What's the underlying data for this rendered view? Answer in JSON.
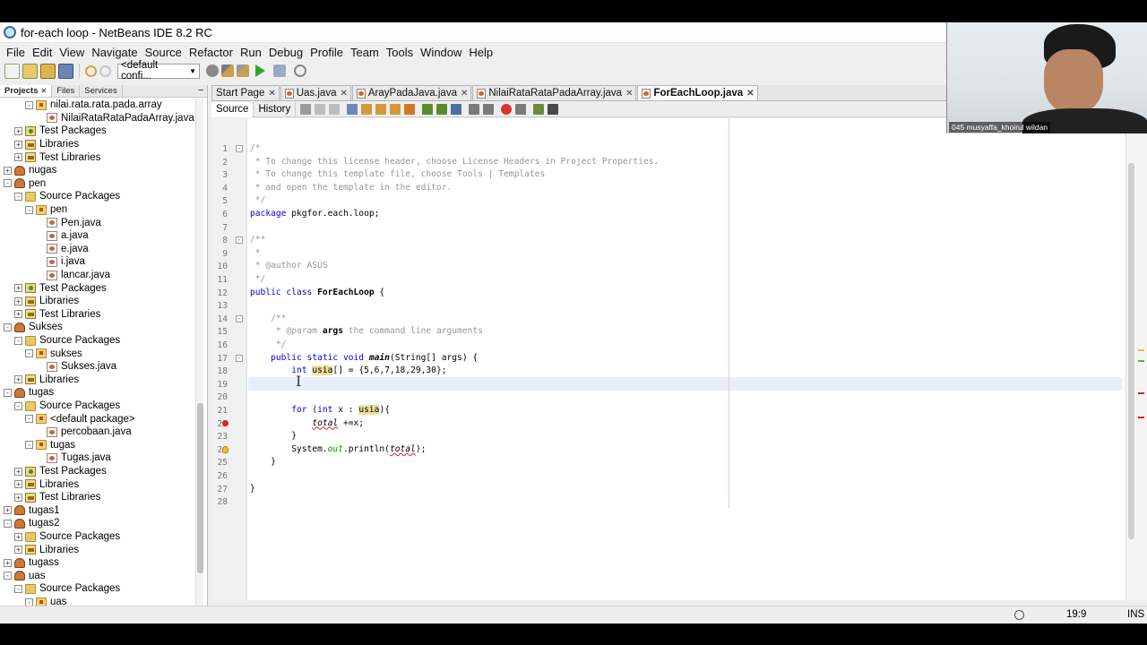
{
  "window": {
    "title": "for-each loop - NetBeans IDE 8.2 RC"
  },
  "menu": [
    "File",
    "Edit",
    "View",
    "Navigate",
    "Source",
    "Refactor",
    "Run",
    "Debug",
    "Profile",
    "Team",
    "Tools",
    "Window",
    "Help"
  ],
  "toolbar": {
    "config": "<default confi..."
  },
  "left_panel": {
    "tabs": [
      "Projects",
      "Files",
      "Services"
    ],
    "minimize": "–"
  },
  "tree": [
    {
      "indent": 2,
      "toggle": "-",
      "icon": "pkg",
      "label": "nilai.rata.rata.pada.array"
    },
    {
      "indent": 3,
      "toggle": "",
      "icon": "java",
      "label": "NilaiRataRataPadaArray.java"
    },
    {
      "indent": 1,
      "toggle": "+",
      "icon": "testpkg",
      "label": "Test Packages"
    },
    {
      "indent": 1,
      "toggle": "+",
      "icon": "libs",
      "label": "Libraries"
    },
    {
      "indent": 1,
      "toggle": "+",
      "icon": "libs",
      "label": "Test Libraries"
    },
    {
      "indent": 0,
      "toggle": "+",
      "icon": "project",
      "label": "nugas"
    },
    {
      "indent": 0,
      "toggle": "-",
      "icon": "project",
      "label": "pen"
    },
    {
      "indent": 1,
      "toggle": "-",
      "icon": "folder",
      "label": "Source Packages"
    },
    {
      "indent": 2,
      "toggle": "-",
      "icon": "pkg",
      "label": "pen"
    },
    {
      "indent": 3,
      "toggle": "",
      "icon": "java",
      "label": "Pen.java"
    },
    {
      "indent": 3,
      "toggle": "",
      "icon": "java",
      "label": "a.java"
    },
    {
      "indent": 3,
      "toggle": "",
      "icon": "java",
      "label": "e.java"
    },
    {
      "indent": 3,
      "toggle": "",
      "icon": "java",
      "label": "i.java"
    },
    {
      "indent": 3,
      "toggle": "",
      "icon": "java",
      "label": "lancar.java"
    },
    {
      "indent": 1,
      "toggle": "+",
      "icon": "testpkg",
      "label": "Test Packages"
    },
    {
      "indent": 1,
      "toggle": "+",
      "icon": "libs",
      "label": "Libraries"
    },
    {
      "indent": 1,
      "toggle": "+",
      "icon": "libs",
      "label": "Test Libraries"
    },
    {
      "indent": 0,
      "toggle": "-",
      "icon": "project",
      "label": "Sukses"
    },
    {
      "indent": 1,
      "toggle": "-",
      "icon": "folder",
      "label": "Source Packages"
    },
    {
      "indent": 2,
      "toggle": "-",
      "icon": "pkg",
      "label": "sukses"
    },
    {
      "indent": 3,
      "toggle": "",
      "icon": "java",
      "label": "Sukses.java"
    },
    {
      "indent": 1,
      "toggle": "+",
      "icon": "libs",
      "label": "Libraries"
    },
    {
      "indent": 0,
      "toggle": "-",
      "icon": "project",
      "label": "tugas"
    },
    {
      "indent": 1,
      "toggle": "-",
      "icon": "folder",
      "label": "Source Packages"
    },
    {
      "indent": 2,
      "toggle": "-",
      "icon": "pkg",
      "label": "<default package>"
    },
    {
      "indent": 3,
      "toggle": "",
      "icon": "java",
      "label": "percobaan.java"
    },
    {
      "indent": 2,
      "toggle": "-",
      "icon": "pkg",
      "label": "tugas"
    },
    {
      "indent": 3,
      "toggle": "",
      "icon": "java",
      "label": "Tugas.java"
    },
    {
      "indent": 1,
      "toggle": "+",
      "icon": "testpkg",
      "label": "Test Packages"
    },
    {
      "indent": 1,
      "toggle": "+",
      "icon": "libs",
      "label": "Libraries"
    },
    {
      "indent": 1,
      "toggle": "+",
      "icon": "libs",
      "label": "Test Libraries"
    },
    {
      "indent": 0,
      "toggle": "+",
      "icon": "project",
      "label": "tugas1"
    },
    {
      "indent": 0,
      "toggle": "-",
      "icon": "project",
      "label": "tugas2"
    },
    {
      "indent": 1,
      "toggle": "+",
      "icon": "folder",
      "label": "Source Packages"
    },
    {
      "indent": 1,
      "toggle": "+",
      "icon": "libs",
      "label": "Libraries"
    },
    {
      "indent": 0,
      "toggle": "+",
      "icon": "project",
      "label": "tugass"
    },
    {
      "indent": 0,
      "toggle": "-",
      "icon": "project",
      "label": "uas"
    },
    {
      "indent": 1,
      "toggle": "-",
      "icon": "folder",
      "label": "Source Packages"
    },
    {
      "indent": 2,
      "toggle": "-",
      "icon": "pkg",
      "label": "uas"
    }
  ],
  "editor_tabs": [
    {
      "label": "Start Page",
      "active": false,
      "file": false
    },
    {
      "label": "Uas.java",
      "active": false,
      "file": true
    },
    {
      "label": "ArayPadaJava.java",
      "active": false,
      "file": true
    },
    {
      "label": "NilaiRataRataPadaArray.java",
      "active": false,
      "file": true
    },
    {
      "label": "ForEachLoop.java",
      "active": true,
      "file": true
    }
  ],
  "editor_subtabs": [
    "Source",
    "History"
  ],
  "code": [
    {
      "n": 1,
      "fold": "-",
      "mark": "",
      "tokens": [
        [
          "/*",
          "c"
        ]
      ]
    },
    {
      "n": 2,
      "fold": "",
      "mark": "",
      "tokens": [
        [
          " * To change this license header, choose License Headers in Project Properties.",
          "c"
        ]
      ]
    },
    {
      "n": 3,
      "fold": "",
      "mark": "",
      "tokens": [
        [
          " * To change this template file, choose Tools | Templates",
          "c"
        ]
      ]
    },
    {
      "n": 4,
      "fold": "",
      "mark": "",
      "tokens": [
        [
          " * and open the template in the editor.",
          "c"
        ]
      ]
    },
    {
      "n": 5,
      "fold": "",
      "mark": "",
      "tokens": [
        [
          " */",
          "c"
        ]
      ]
    },
    {
      "n": 6,
      "fold": "",
      "mark": "",
      "tokens": [
        [
          "package",
          "k"
        ],
        [
          " pkgfor.each.loop;",
          ""
        ]
      ]
    },
    {
      "n": 7,
      "fold": "",
      "mark": "",
      "tokens": []
    },
    {
      "n": 8,
      "fold": "-",
      "mark": "",
      "tokens": [
        [
          "/**",
          "c"
        ]
      ]
    },
    {
      "n": 9,
      "fold": "",
      "mark": "",
      "tokens": [
        [
          " *",
          "c"
        ]
      ]
    },
    {
      "n": 10,
      "fold": "",
      "mark": "",
      "tokens": [
        [
          " * @author ASUS",
          "c"
        ]
      ]
    },
    {
      "n": 11,
      "fold": "",
      "mark": "",
      "tokens": [
        [
          " */",
          "c"
        ]
      ]
    },
    {
      "n": 12,
      "fold": "",
      "mark": "",
      "tokens": [
        [
          "public class",
          "k"
        ],
        [
          " ",
          ""
        ],
        [
          "ForEachLoop",
          "b"
        ],
        [
          " {",
          ""
        ]
      ]
    },
    {
      "n": 13,
      "fold": "",
      "mark": "",
      "tokens": []
    },
    {
      "n": 14,
      "fold": "-",
      "mark": "",
      "tokens": [
        [
          "    /**",
          "c"
        ]
      ]
    },
    {
      "n": 15,
      "fold": "",
      "mark": "",
      "tokens": [
        [
          "     * @param ",
          "c"
        ],
        [
          "args",
          "b"
        ],
        [
          " the command line arguments",
          "c"
        ]
      ]
    },
    {
      "n": 16,
      "fold": "",
      "mark": "",
      "tokens": [
        [
          "     */",
          "c"
        ]
      ]
    },
    {
      "n": 17,
      "fold": "-",
      "mark": "",
      "tokens": [
        [
          "    ",
          ""
        ],
        [
          "public static void",
          "k"
        ],
        [
          " ",
          ""
        ],
        [
          "main",
          "bi"
        ],
        [
          "(String[] args) {",
          ""
        ]
      ]
    },
    {
      "n": 18,
      "fold": "",
      "mark": "",
      "tokens": [
        [
          "        ",
          ""
        ],
        [
          "int",
          "k"
        ],
        [
          " ",
          ""
        ],
        [
          "usia",
          "h"
        ],
        [
          "[] = {5,6,7,18,29,30};",
          ""
        ]
      ]
    },
    {
      "n": 19,
      "fold": "",
      "mark": "",
      "tokens": []
    },
    {
      "n": 20,
      "fold": "",
      "mark": "",
      "tokens": []
    },
    {
      "n": 21,
      "fold": "",
      "mark": "",
      "tokens": [
        [
          "        ",
          ""
        ],
        [
          "for",
          "k"
        ],
        [
          " (",
          ""
        ],
        [
          "int",
          "k"
        ],
        [
          " x : ",
          ""
        ],
        [
          "usia",
          "h"
        ],
        [
          "){",
          ""
        ]
      ]
    },
    {
      "n": 22,
      "fold": "",
      "mark": "err",
      "tokens": [
        [
          "            ",
          ""
        ],
        [
          "total",
          "e"
        ],
        [
          " +=x;",
          ""
        ]
      ]
    },
    {
      "n": 23,
      "fold": "",
      "mark": "",
      "tokens": [
        [
          "        }",
          ""
        ]
      ]
    },
    {
      "n": 24,
      "fold": "",
      "mark": "bulb",
      "tokens": [
        [
          "        System.",
          ""
        ],
        [
          "out",
          "f"
        ],
        [
          ".println(",
          ""
        ],
        [
          "total",
          "e"
        ],
        [
          ");",
          ""
        ]
      ]
    },
    {
      "n": 25,
      "fold": "",
      "mark": "",
      "tokens": [
        [
          "    }",
          ""
        ]
      ]
    },
    {
      "n": 26,
      "fold": "",
      "mark": "",
      "tokens": []
    },
    {
      "n": 27,
      "fold": "",
      "mark": "",
      "tokens": [
        [
          "}",
          ""
        ]
      ]
    },
    {
      "n": 28,
      "fold": "",
      "mark": "",
      "tokens": []
    }
  ],
  "status": {
    "position": "19:9",
    "mode": "INS"
  },
  "webcam": {
    "participant": "045 musyaffa_khoirul wildan"
  }
}
